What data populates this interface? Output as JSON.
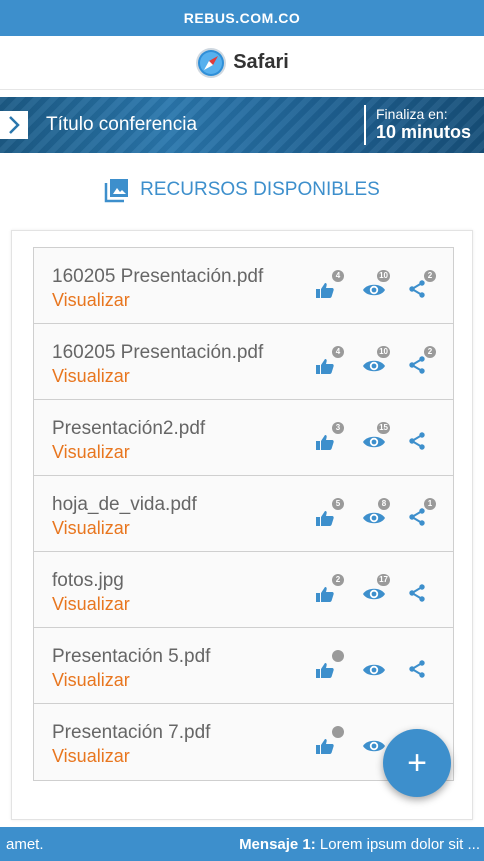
{
  "top_banner": {
    "domain": "REBUS.COM.CO"
  },
  "app": {
    "name": "Safari"
  },
  "conference": {
    "title": "Título conferencia",
    "ends_label": "Finaliza en:",
    "ends_value": "10 minutos"
  },
  "resources": {
    "heading": "RECURSOS DISPONIBLES",
    "view_label": "Visualizar",
    "items": [
      {
        "name": "160205 Presentación.pdf",
        "likes": "4",
        "views": "10",
        "shares": "2"
      },
      {
        "name": "160205 Presentación.pdf",
        "likes": "4",
        "views": "10",
        "shares": "2"
      },
      {
        "name": "Presentación2.pdf",
        "likes": "3",
        "views": "15",
        "shares": ""
      },
      {
        "name": "hoja_de_vida.pdf",
        "likes": "5",
        "views": "8",
        "shares": "1"
      },
      {
        "name": "fotos.jpg",
        "likes": "2",
        "views": "17",
        "shares": ""
      },
      {
        "name": "Presentación 5.pdf",
        "likes": "",
        "views": "",
        "shares": ""
      },
      {
        "name": "Presentación 7.pdf",
        "likes": "",
        "views": "",
        "shares": ""
      }
    ]
  },
  "fab": {
    "label": "+"
  },
  "ticker": {
    "left_text": "amet.",
    "message_label": "Mensaje 1:",
    "message_text": " Lorem ipsum dolor sit ..."
  },
  "colors": {
    "accent": "#3d8fcc",
    "link": "#e8761f",
    "badge": "#9a9a9a"
  },
  "icons": {
    "like": "thumbs-up-icon",
    "view": "eye-icon",
    "share": "share-icon",
    "section": "image-gallery-icon",
    "expand": "chevron-right-icon"
  }
}
